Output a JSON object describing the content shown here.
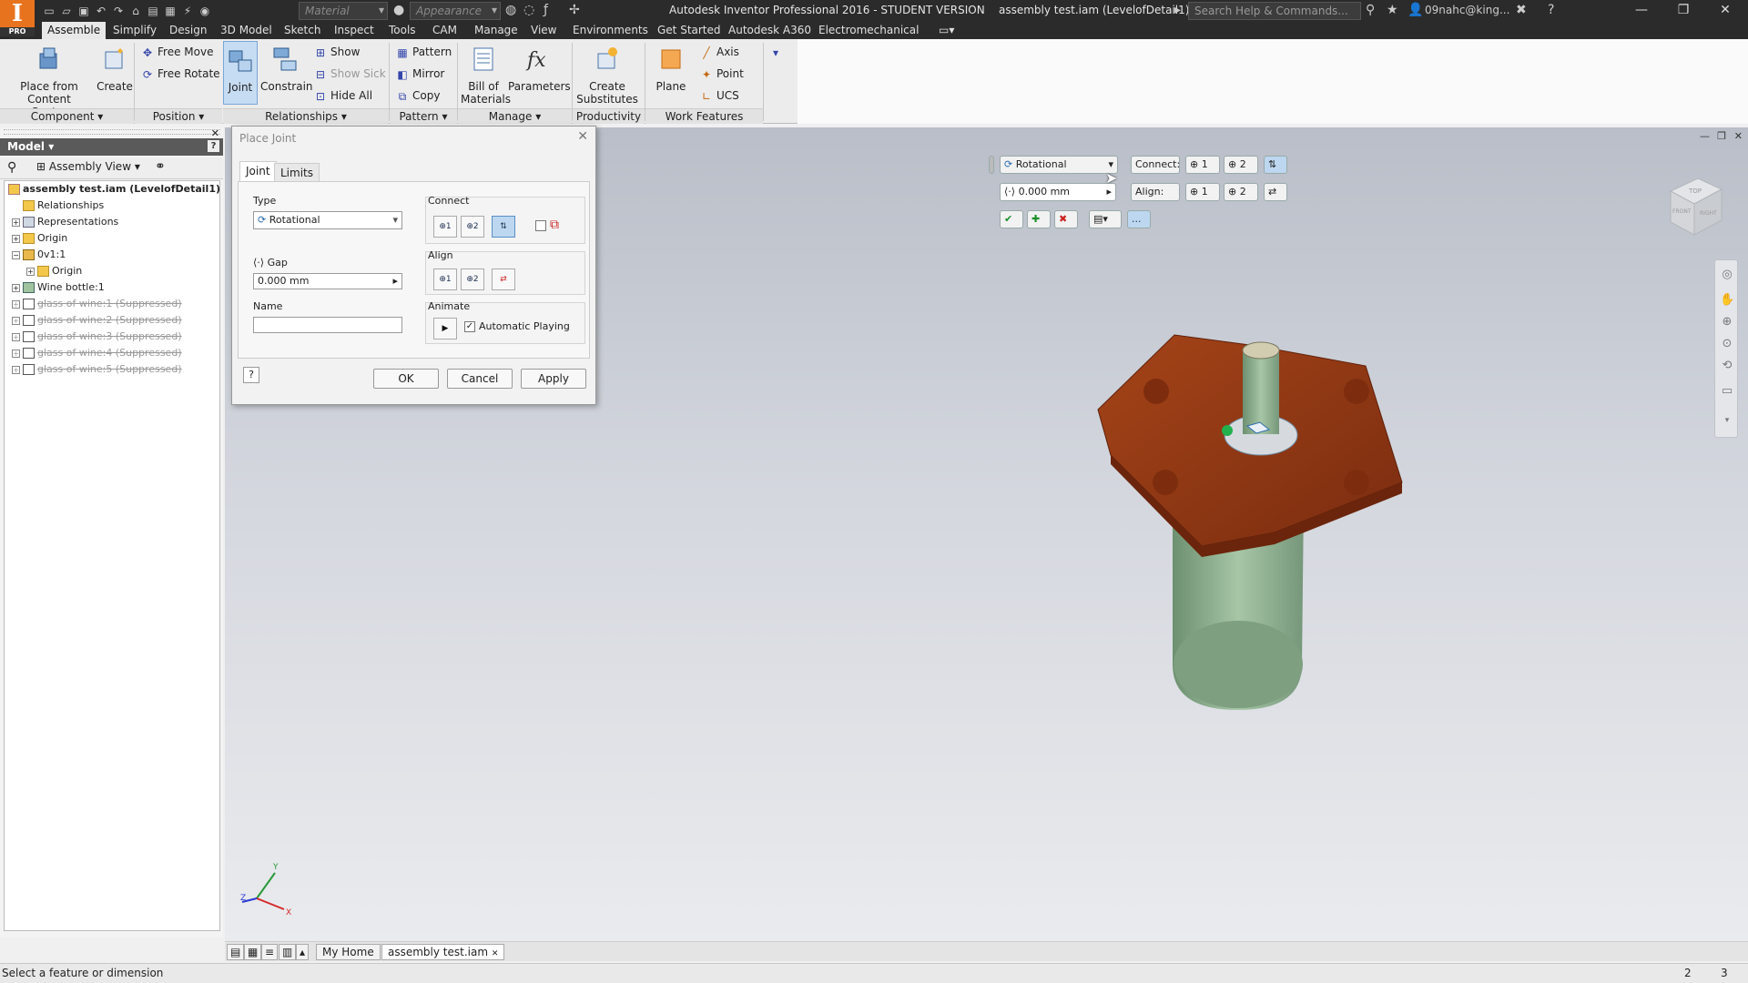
{
  "app": {
    "logo_text": "I",
    "logo_badge": "PRO",
    "window_title": "Autodesk Inventor Professional 2016 - STUDENT VERSION    assembly test.iam (LevelofDetail1)"
  },
  "titlebar": {
    "material_placeholder": "Material",
    "appearance_placeholder": "Appearance",
    "search_placeholder": "Search Help & Commands...",
    "user": "09nahc@king..."
  },
  "ribbon_tabs": [
    "Assemble",
    "Simplify",
    "Design",
    "3D Model",
    "Sketch",
    "Inspect",
    "Tools",
    "CAM",
    "Manage",
    "View",
    "Environments",
    "Get Started",
    "Autodesk A360",
    "Electromechanical"
  ],
  "ribbon": {
    "place_from_cc": [
      "Place from",
      "Content Center"
    ],
    "create": "Create",
    "free_move": "Free Move",
    "free_rotate": "Free Rotate",
    "joint": "Joint",
    "constrain": "Constrain",
    "show": "Show",
    "show_sick": "Show Sick",
    "hide_all": "Hide All",
    "pattern": "Pattern",
    "mirror": "Mirror",
    "copy": "Copy",
    "bom": [
      "Bill of",
      "Materials"
    ],
    "parameters": "Parameters",
    "create_subs": [
      "Create",
      "Substitutes"
    ],
    "plane": "Plane",
    "axis": "Axis",
    "point": "Point",
    "ucs": "UCS",
    "panels": [
      "Component",
      "Position",
      "Relationships",
      "Pattern",
      "Manage",
      "Productivity",
      "Work Features"
    ]
  },
  "browser": {
    "title": "Model",
    "view": "Assembly View",
    "nodes": [
      {
        "label": "assembly test.iam (LevelofDetail1)",
        "bold": true
      },
      {
        "label": "Relationships"
      },
      {
        "label": "Representations"
      },
      {
        "label": "Origin"
      },
      {
        "label": "0v1:1"
      },
      {
        "label": "Origin"
      },
      {
        "label": "Wine bottle:1"
      },
      {
        "label": "glass of wine:1 (Suppressed)"
      },
      {
        "label": "glass of wine:2 (Suppressed)"
      },
      {
        "label": "glass of wine:3 (Suppressed)"
      },
      {
        "label": "glass of wine:4 (Suppressed)"
      },
      {
        "label": "glass of wine:5 (Suppressed)"
      }
    ]
  },
  "dialog": {
    "title": "Place Joint",
    "tabs": [
      "Joint",
      "Limits"
    ],
    "type_label": "Type",
    "type_value": "Rotational",
    "gap_label": "Gap",
    "gap_value": "0.000 mm",
    "name_label": "Name",
    "name_value": "",
    "connect_label": "Connect",
    "align_label": "Align",
    "animate_label": "Animate",
    "auto_play": "Automatic Playing",
    "ok": "OK",
    "cancel": "Cancel",
    "apply": "Apply"
  },
  "mini_toolbar": {
    "type": "Rotational",
    "connect_label": "Connect:",
    "align_label": "Align:",
    "gap": "0.000 mm",
    "btn1": "1",
    "btn2": "2",
    "more": "..."
  },
  "viewcube": {
    "top": "TOP",
    "right": "RIGHT",
    "front": "FRONT"
  },
  "triad": {
    "x": "X",
    "y": "Y",
    "z": "Z"
  },
  "doc_tabs": [
    "My Home",
    "assembly test.iam"
  ],
  "status": {
    "message": "Select a feature or dimension",
    "count1": "2",
    "count2": "3"
  },
  "colors": {
    "accent": "#e8731e",
    "part_wood": "#8f3514",
    "bottle": "#8fb090"
  }
}
